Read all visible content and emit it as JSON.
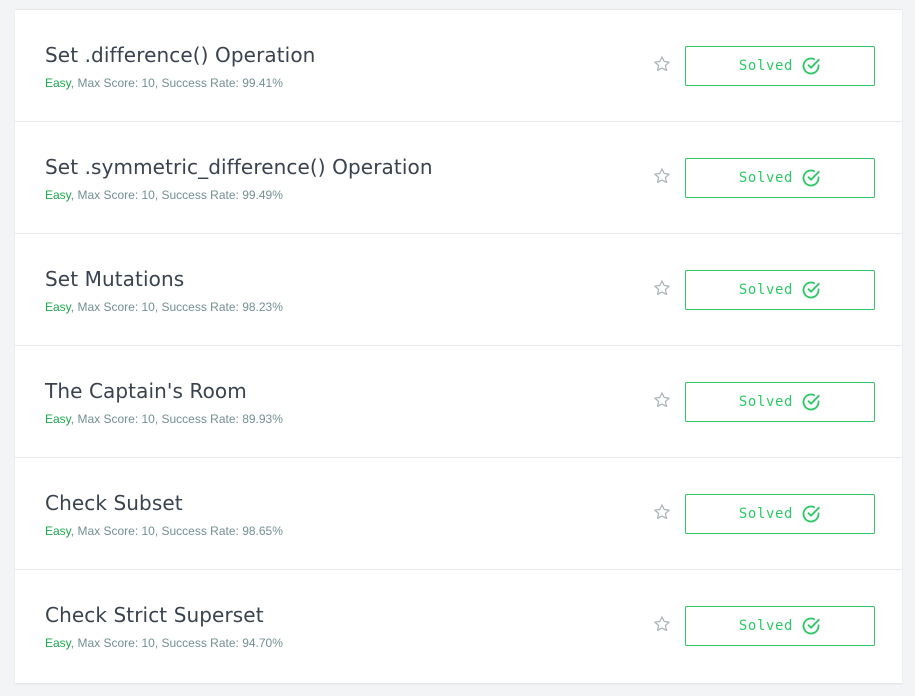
{
  "colors": {
    "accent_green": "#2ec866",
    "difficulty_green": "#1ba94c",
    "title_text": "#39424e",
    "meta_text": "#738f93",
    "star_outline": "#a8b2b8"
  },
  "challenges": [
    {
      "title": "Set .difference() Operation",
      "difficulty": "Easy",
      "details": ", Max Score: 10, Success Rate: 99.41%",
      "status_label": "Solved",
      "star_icon": "star-outline-icon",
      "status_icon": "check-circle-icon"
    },
    {
      "title": "Set .symmetric_difference() Operation",
      "difficulty": "Easy",
      "details": ", Max Score: 10, Success Rate: 99.49%",
      "status_label": "Solved",
      "star_icon": "star-outline-icon",
      "status_icon": "check-circle-icon"
    },
    {
      "title": "Set Mutations",
      "difficulty": "Easy",
      "details": ", Max Score: 10, Success Rate: 98.23%",
      "status_label": "Solved",
      "star_icon": "star-outline-icon",
      "status_icon": "check-circle-icon"
    },
    {
      "title": "The Captain's Room",
      "difficulty": "Easy",
      "details": ", Max Score: 10, Success Rate: 89.93%",
      "status_label": "Solved",
      "star_icon": "star-outline-icon",
      "status_icon": "check-circle-icon"
    },
    {
      "title": "Check Subset",
      "difficulty": "Easy",
      "details": ", Max Score: 10, Success Rate: 98.65%",
      "status_label": "Solved",
      "star_icon": "star-outline-icon",
      "status_icon": "check-circle-icon"
    },
    {
      "title": "Check Strict Superset",
      "difficulty": "Easy",
      "details": ", Max Score: 10, Success Rate: 94.70%",
      "status_label": "Solved",
      "star_icon": "star-outline-icon",
      "status_icon": "check-circle-icon"
    }
  ]
}
